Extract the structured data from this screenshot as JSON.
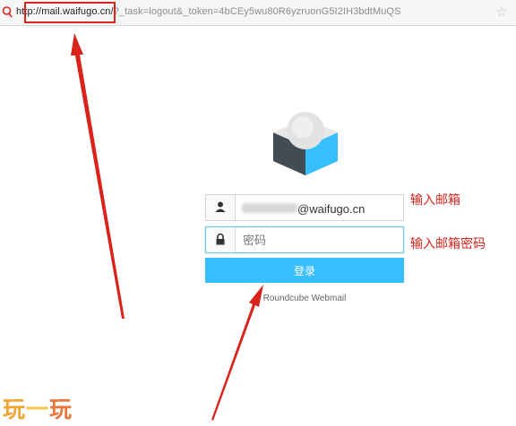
{
  "browser": {
    "url_host": "http://mail.waifugo.cn/",
    "url_rest": "?_task=logout&_token=4bCEy5wu80R6yzruonG5I2IH3bdtMuQS"
  },
  "login": {
    "email_value": "@waifugo.cn",
    "password_placeholder": "密码",
    "submit_label": "登录",
    "footer": "Roundcube Webmail"
  },
  "annotations": {
    "email_note": "输入邮箱",
    "password_note": "输入邮箱密码",
    "highlight_color": "#d9231b"
  },
  "watermark": {
    "chars": [
      "玩",
      "一",
      "玩"
    ]
  },
  "colors": {
    "button": "#37beff",
    "logo_blue": "#37beff",
    "logo_dark": "#424c52"
  }
}
